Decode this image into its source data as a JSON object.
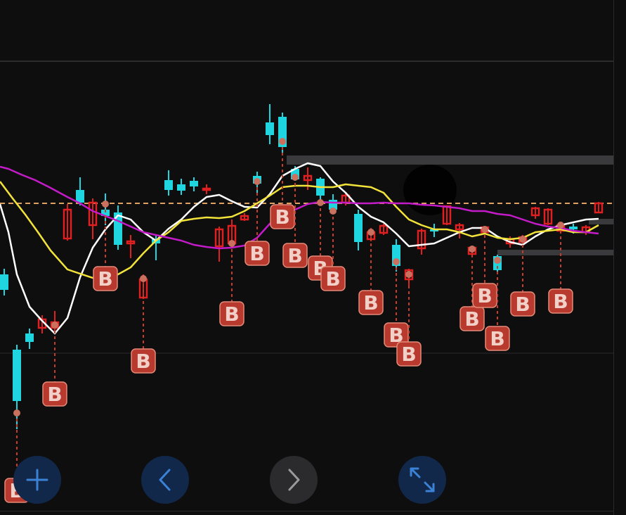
{
  "chart_data": {
    "type": "candlestick",
    "title": "",
    "xlabel": "",
    "ylabel": "",
    "grid": true,
    "series": [
      {
        "color": "#ffffff"
      },
      {
        "color": "#f2e33a"
      },
      {
        "color": "#c41bc9"
      }
    ],
    "reference_line": {
      "style": "dashed",
      "color": "#e0a060"
    },
    "signal_marker": {
      "text": "B",
      "count": 24,
      "color": "#b83a2e"
    },
    "colors": {
      "up": "#e02020",
      "down": "#1fd6e0"
    }
  },
  "controls": {
    "zoom_in": {
      "icon": "plus-icon"
    },
    "previous": {
      "icon": "chevron-left-icon"
    },
    "next": {
      "icon": "chevron-right-icon"
    },
    "fullscreen": {
      "icon": "expand-icon"
    }
  }
}
